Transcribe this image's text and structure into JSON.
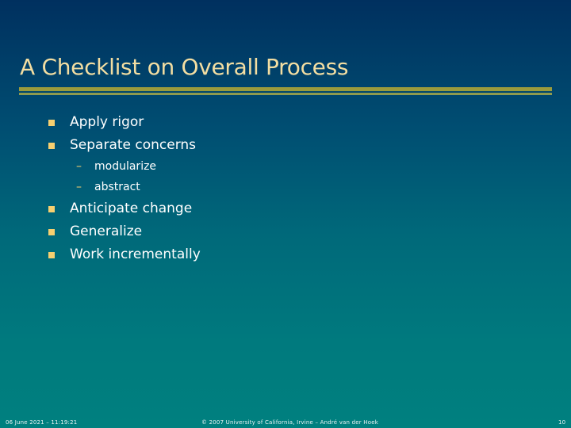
{
  "slide": {
    "title": "A Checklist on Overall Process",
    "bullets": [
      {
        "label": "Apply rigor"
      },
      {
        "label": "Separate concerns",
        "subitems": [
          "modularize",
          "abstract"
        ]
      },
      {
        "label": "Anticipate change"
      },
      {
        "label": "Generalize"
      },
      {
        "label": "Work incrementally"
      }
    ],
    "bullet_icon": "square-bullet-icon",
    "subbullet_icon": "dash-icon"
  },
  "footer": {
    "date": "06 June 2021 – 11:19:21",
    "copyright": "© 2007 University of California, Irvine – André van der Hoek",
    "page_number": "10"
  },
  "colors": {
    "title": "#f3dea2",
    "bullet": "#f6cf70",
    "rule": "#9b9b3c",
    "background_top": "#00305f",
    "background_bottom": "#00807f"
  }
}
